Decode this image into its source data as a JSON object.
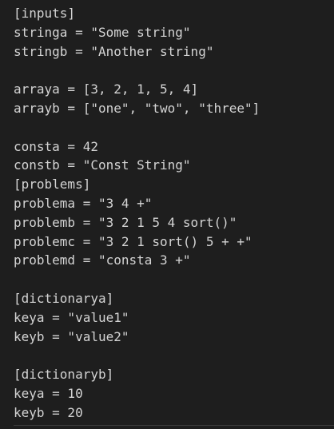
{
  "editor": {
    "lines": [
      "[inputs]",
      "stringa = \"Some string\"",
      "stringb = \"Another string\"",
      "",
      "arraya = [3, 2, 1, 5, 4]",
      "arrayb = [\"one\", \"two\", \"three\"]",
      "",
      "consta = 42",
      "constb = \"Const String\"",
      "[problems]",
      "problema = \"3 4 +\"",
      "problemb = \"3 2 1 5 4 sort()\"",
      "problemc = \"3 2 1 sort() 5 + +\"",
      "problemd = \"consta 3 +\"",
      "",
      "[dictionarya]",
      "keya = \"value1\"",
      "keyb = \"value2\"",
      "",
      "[dictionaryb]",
      "keya = 10",
      "keyb = 20"
    ]
  }
}
